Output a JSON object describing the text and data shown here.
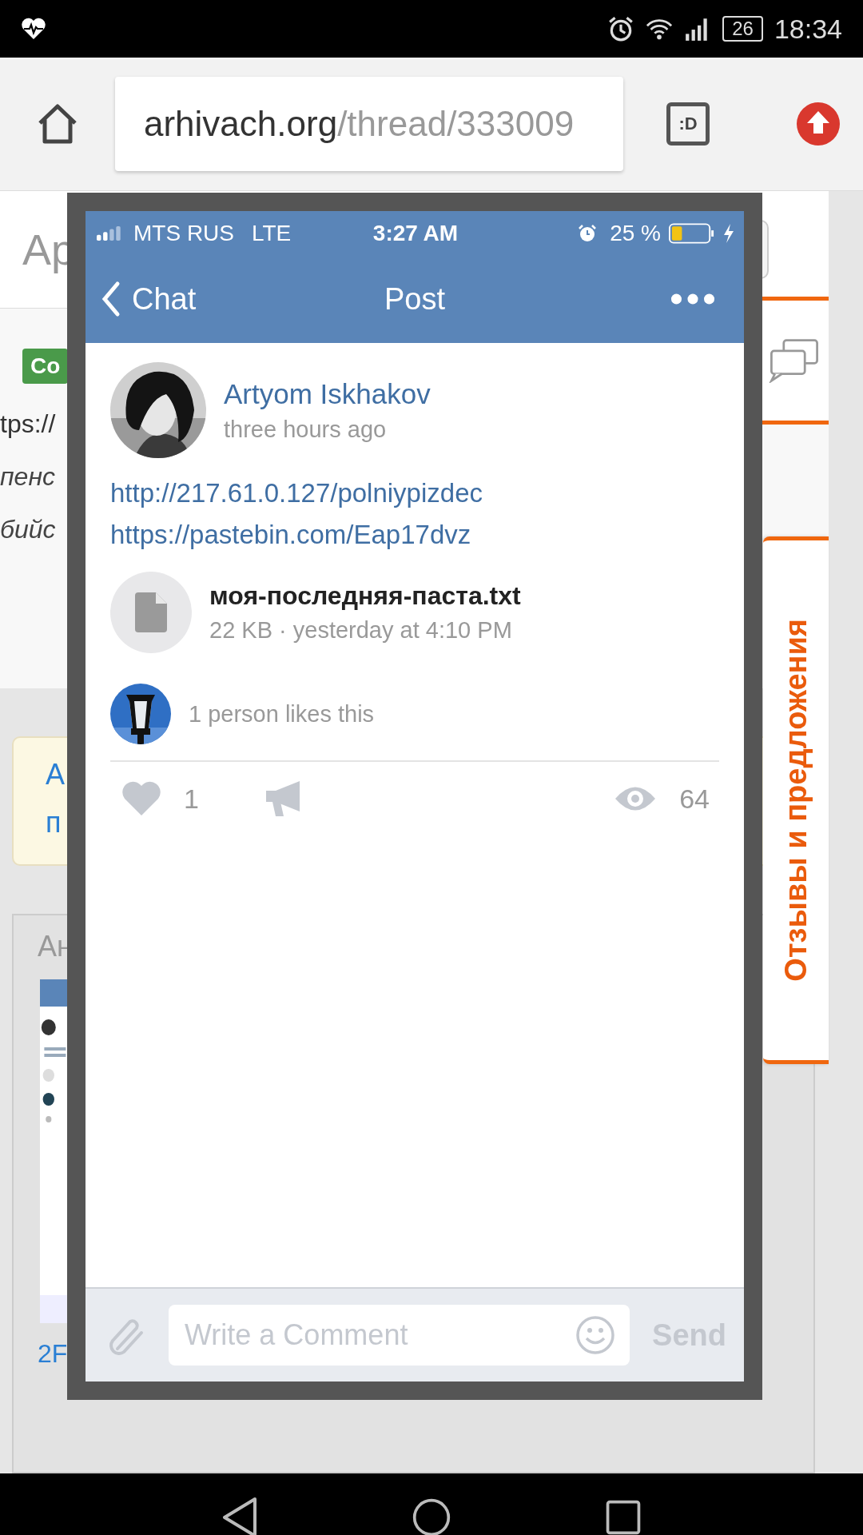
{
  "status_bar": {
    "battery": "26",
    "time": "18:34"
  },
  "browser": {
    "url_host": "arhivach.org",
    "url_path": "/thread/333009",
    "tabs_button": ":D"
  },
  "page": {
    "header_fragment": "Ар",
    "badge": "Со",
    "lines": [
      {
        "text": "tps://",
        "italic": false
      },
      {
        "text": "пенс",
        "italic": true
      },
      {
        "text": "бийс",
        "italic": true
      }
    ],
    "notice_lines": [
      "А",
      "п"
    ],
    "post_header": "Ан",
    "file_link": "2F",
    "feedback_tab": "Отзывы и предложения"
  },
  "viewer": {
    "ios_status": {
      "carrier": "MTS RUS",
      "network": "LTE",
      "time": "3:27 AM",
      "battery": "25 %"
    },
    "nav": {
      "back": "Chat",
      "title": "Post"
    },
    "post": {
      "author": "Artyom Iskhakov",
      "time": "three hours ago",
      "links": [
        "http://217.61.0.127/polniypizdec",
        "https://pastebin.com/Eap17dvz"
      ],
      "attachment": {
        "name": "моя-последняя-паста.txt",
        "meta": "22 KB · yesterday at 4:10 PM"
      },
      "likes_text": "1 person likes this",
      "like_count": "1",
      "liked": false,
      "views": "64"
    },
    "comment": {
      "placeholder": "Write a Comment",
      "send": "Send"
    }
  }
}
